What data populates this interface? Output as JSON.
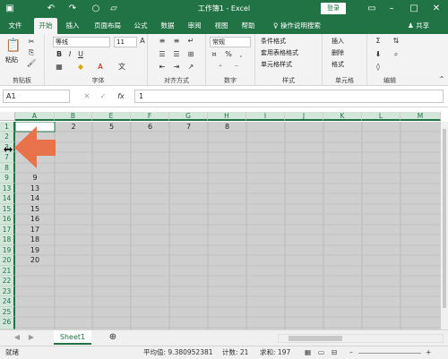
{
  "titlebar": {
    "title": "工作簿1 - Excel",
    "login_label": "登录"
  },
  "tabs": [
    "文件",
    "开始",
    "插入",
    "页面布局",
    "公式",
    "数据",
    "审阅",
    "视图",
    "帮助"
  ],
  "tell_me": "操作说明搜索",
  "share": "共享",
  "ribbon": {
    "clipboard": {
      "paste": "粘贴",
      "label": "剪贴板"
    },
    "font": {
      "name": "等线",
      "size": "11",
      "label": "字体"
    },
    "alignment": {
      "label": "对齐方式"
    },
    "number": {
      "format": "常规",
      "label": "数字"
    },
    "styles": {
      "conditional": "条件格式",
      "table": "套用表格格式",
      "cell_styles": "单元格样式",
      "label": "样式"
    },
    "cells": {
      "insert": "插入",
      "delete": "删除",
      "format": "格式",
      "label": "单元格"
    },
    "editing": {
      "label": "编辑"
    }
  },
  "formula": {
    "name_box": "A1",
    "value": "1"
  },
  "columns": [
    "A",
    "B",
    "E",
    "F",
    "G",
    "H",
    "I",
    "J",
    "K",
    "L",
    "M"
  ],
  "rows": [
    "1",
    "2",
    "3",
    "7",
    "8",
    "9",
    "13",
    "14",
    "15",
    "16",
    "17",
    "18",
    "19",
    "20",
    "21",
    "22",
    "23",
    "24",
    "25",
    "26"
  ],
  "row1_values": [
    "2",
    "5",
    "6",
    "7",
    "8"
  ],
  "colA_values": [
    "9",
    "13",
    "14",
    "15",
    "16",
    "17",
    "18",
    "19",
    "20"
  ],
  "sheet_tab": "Sheet1",
  "status": {
    "ready": "就绪",
    "average": "平均值: 9.380952381",
    "count": "计数: 21",
    "sum": "求和: 197"
  },
  "colors": {
    "accent": "#217346",
    "arrow": "#e8734a"
  }
}
